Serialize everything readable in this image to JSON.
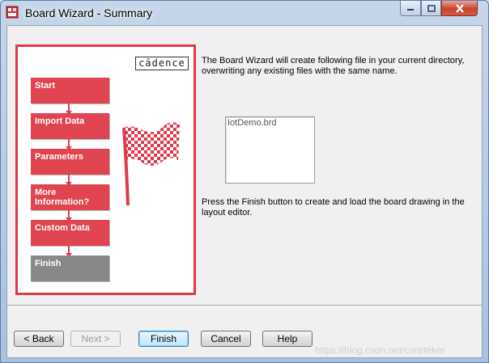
{
  "window": {
    "title": "Board Wizard - Summary"
  },
  "panel": {
    "logo": "cādence",
    "steps": [
      {
        "label": "Start"
      },
      {
        "label": "Import Data"
      },
      {
        "label": "Parameters"
      },
      {
        "label": "More Information?"
      },
      {
        "label": "Custom Data"
      },
      {
        "label": "Finish"
      }
    ],
    "accent": "#df3a4b",
    "inactive_step_color": "#888888"
  },
  "content": {
    "description": "The Board Wizard will create following file in your current directory, overwriting any existing files with the same name.",
    "files": [
      "IotDemo.brd"
    ],
    "instruction": "Press the Finish button to create and load the board drawing in the layout editor."
  },
  "buttons": {
    "back": "< Back",
    "next": "Next >",
    "finish": "Finish",
    "cancel": "Cancel",
    "help": "Help"
  },
  "watermark": "https://blog.csdn.net/coreteker",
  "icons": {
    "app": "board-wizard-app-icon",
    "minimize": "minimize-icon",
    "maximize": "maximize-icon",
    "close": "close-icon",
    "flag": "checkered-flag-icon"
  }
}
